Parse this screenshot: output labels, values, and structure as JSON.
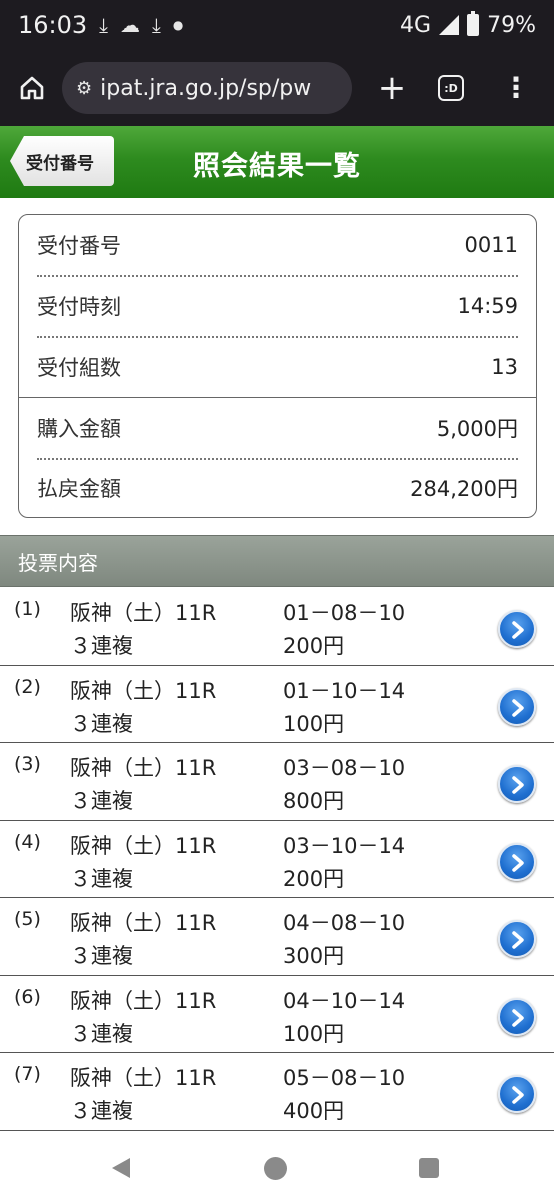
{
  "status_bar": {
    "time": "16:03",
    "network": "4G",
    "battery": "79%",
    "icons": [
      "download-icon",
      "weather-icon",
      "download-icon",
      "dot-icon"
    ]
  },
  "browser": {
    "url": "ipat.jra.go.jp/sp/pw",
    "tabs_label": ":D"
  },
  "header": {
    "back_label": "受付番号",
    "title": "照会結果一覧",
    "accent_color": "#2e8b1f"
  },
  "summary": {
    "rows": [
      {
        "label": "受付番号",
        "value": "0011"
      },
      {
        "label": "受付時刻",
        "value": "14:59"
      },
      {
        "label": "受付組数",
        "value": "13"
      },
      {
        "label": "購入金額",
        "value": "5,000円"
      },
      {
        "label": "払戻金額",
        "value": "284,200円"
      }
    ]
  },
  "section": {
    "title": "投票内容"
  },
  "bets": [
    {
      "index": "(1)",
      "race": "阪神（土）11R",
      "bet_type": "３連複",
      "combo": "01－08－10",
      "amount": "200円"
    },
    {
      "index": "(2)",
      "race": "阪神（土）11R",
      "bet_type": "３連複",
      "combo": "01－10－14",
      "amount": "100円"
    },
    {
      "index": "(3)",
      "race": "阪神（土）11R",
      "bet_type": "３連複",
      "combo": "03－08－10",
      "amount": "800円"
    },
    {
      "index": "(4)",
      "race": "阪神（土）11R",
      "bet_type": "３連複",
      "combo": "03－10－14",
      "amount": "200円"
    },
    {
      "index": "(5)",
      "race": "阪神（土）11R",
      "bet_type": "３連複",
      "combo": "04－08－10",
      "amount": "300円"
    },
    {
      "index": "(6)",
      "race": "阪神（土）11R",
      "bet_type": "３連複",
      "combo": "04－10－14",
      "amount": "100円"
    },
    {
      "index": "(7)",
      "race": "阪神（土）11R",
      "bet_type": "３連複",
      "combo": "05－08－10",
      "amount": "400円"
    }
  ]
}
